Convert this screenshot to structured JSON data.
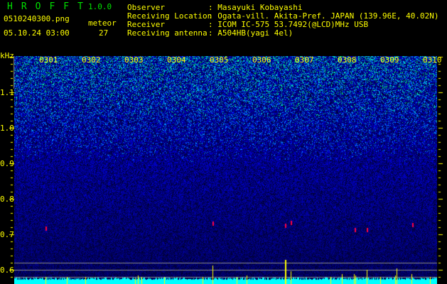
{
  "header": {
    "app_title": "HROFFT",
    "version": "1.0.0",
    "filename": "0510240300.png",
    "datetime": "05.10.24 03:00",
    "meteor_label": "meteor",
    "meteor_count": "27"
  },
  "info": {
    "observer_label": "Observer",
    "observer": ": Masayuki Kobayashi",
    "location_label": "Receiving Location",
    "location": ": Ogata-vill. Akita-Pref. JAPAN (139.96E, 40.02N)",
    "receiver_label": "Receiver",
    "receiver": ": ICOM IC-575 53.7492(@LCD)MHz USB",
    "antenna_label": "Receiving antenna",
    "antenna": ": A504HB(yagi 4el)"
  },
  "spectrogram": {
    "y_unit": "kHz",
    "y_ticks": [
      "1.1",
      "1.0",
      "0.9",
      "0.8",
      "0.7",
      "0.6"
    ],
    "minute_labels": [
      "0301",
      "0302",
      "0303",
      "0304",
      "0305",
      "0306",
      "0307",
      "0308",
      "0309",
      "0310"
    ],
    "colors": {
      "background": "#000080",
      "noise": "#0000ff",
      "signal": "#00ffff",
      "strong": "#ff0040",
      "meteor_bar": "#ffff00",
      "level": "#00ffff"
    }
  }
}
